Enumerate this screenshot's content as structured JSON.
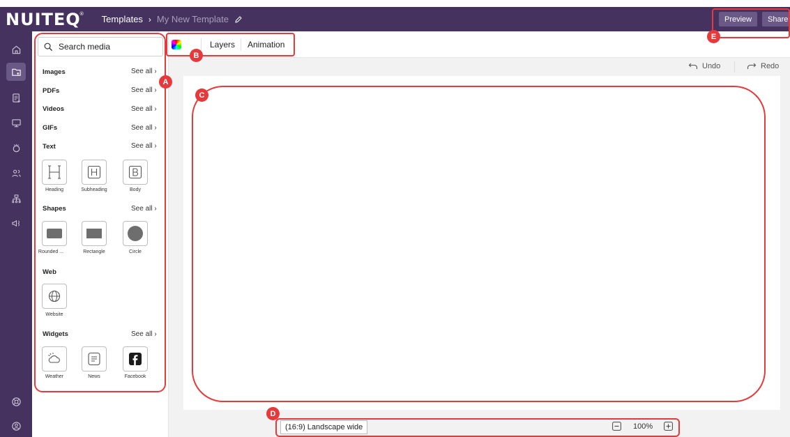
{
  "app": {
    "logo": "NUITEQ",
    "logo_mark": "®"
  },
  "breadcrumb": {
    "root": "Templates",
    "separator": "›",
    "current": "My New Template"
  },
  "header": {
    "preview_label": "Preview",
    "share_label": "Share"
  },
  "rail": {
    "items": [
      "home-icon",
      "media-folder-icon",
      "content-icon",
      "screens-icon",
      "apps-icon",
      "users-icon",
      "hierarchy-icon",
      "broadcast-icon"
    ],
    "bottom": [
      "help-icon",
      "account-icon"
    ]
  },
  "panel": {
    "search_placeholder": "Search media",
    "see_all": "See all ›",
    "sections": {
      "images": "Images",
      "pdfs": "PDFs",
      "videos": "Videos",
      "gifs": "GIFs",
      "text": "Text",
      "shapes": "Shapes",
      "web": "Web",
      "widgets": "Widgets"
    },
    "text_items": [
      "Heading",
      "Subheading",
      "Body"
    ],
    "shape_items": [
      "Rounded ...",
      "Rectangle",
      "Circle"
    ],
    "web_items": [
      "Website"
    ],
    "widget_items": [
      "Weather",
      "News",
      "Facebook"
    ]
  },
  "toolbar": {
    "layers_label": "Layers",
    "animation_label": "Animation"
  },
  "history": {
    "undo_label": "Undo",
    "redo_label": "Redo"
  },
  "footer": {
    "ratio_label": "(16:9) Landscape wide",
    "zoom_level": "100%"
  },
  "annotations": {
    "a": "A",
    "b": "B",
    "c": "C",
    "d": "D",
    "e": "E"
  },
  "colors": {
    "brand": "#46325e",
    "button": "#6a5887",
    "annotation": "#e5393b"
  }
}
